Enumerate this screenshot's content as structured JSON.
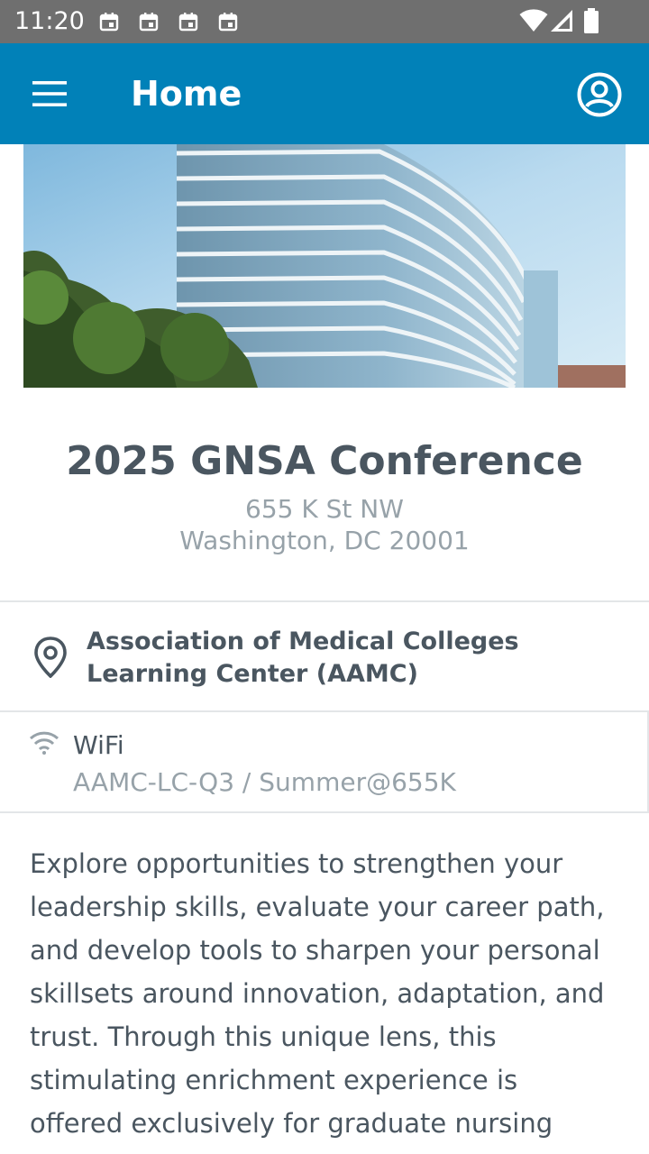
{
  "status_bar": {
    "time": "11:20",
    "notification_icons": [
      "calendar-icon",
      "calendar-icon",
      "calendar-icon",
      "calendar-icon"
    ],
    "system_icons": [
      "wifi-icon",
      "cellular-signal-icon",
      "battery-icon"
    ]
  },
  "app_bar": {
    "title": "Home",
    "menu_icon": "hamburger-menu-icon",
    "account_icon": "account-circle-icon",
    "color": "#0181b8"
  },
  "event": {
    "title": "2025 GNSA Conference",
    "address_line1": "655 K St NW",
    "address_line2": "Washington, DC 20001"
  },
  "venue": {
    "icon": "location-pin-icon",
    "name": "Association of Medical Colleges Learning Center (AAMC)"
  },
  "wifi": {
    "icon": "wifi-icon",
    "label": "WiFi",
    "credentials": "AAMC-LC-Q3 / Summer@655K"
  },
  "description": "Explore opportunities to strengthen your leadership skills, evaluate your career path, and develop tools to sharpen your personal skillsets around innovation, adaptation, and trust. Through this unique lens, this stimulating enrichment experience is offered exclusively for graduate nursing students in"
}
